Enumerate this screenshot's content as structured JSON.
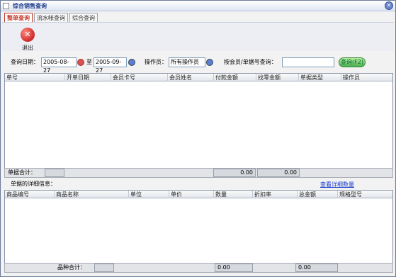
{
  "window": {
    "title": "综合销售查询",
    "close_symbol": "✕"
  },
  "tabs": [
    {
      "label": "整单查询",
      "active": true
    },
    {
      "label": "流水帐查询",
      "active": false
    },
    {
      "label": "综合查询",
      "active": false
    }
  ],
  "toolbar": {
    "exit_symbol": "✕",
    "exit_label": "退出"
  },
  "query": {
    "date_label": "查询日期：",
    "date_from": "2005-08-27",
    "to_label": "至",
    "date_to": "2005-09-27",
    "operator_label": "操作员：",
    "operator_value": "所有操作员",
    "member_label": "按会员/单据号查询：",
    "member_value": "",
    "query_button": "查询(F2)"
  },
  "orders_table": {
    "columns": [
      "单号",
      "开单日期",
      "会员卡号",
      "会员姓名",
      "付款金额",
      "找零金额",
      "单据类型",
      "操作员"
    ],
    "rows": []
  },
  "orders_summary": {
    "label": "单据合计：",
    "count": "",
    "amount": "0.00",
    "change": "0.00"
  },
  "detail": {
    "label": "单据的详细信息：",
    "link": "查看详细数量"
  },
  "detail_table": {
    "columns": [
      "商品编号",
      "商品名称",
      "单位",
      "单价",
      "数量",
      "折扣率",
      "总金额",
      "规格型号"
    ],
    "rows": []
  },
  "detail_summary": {
    "label": "品种合计：",
    "count": "",
    "quantity": "0.00",
    "total": "0.00"
  },
  "colors": {
    "accent": "#c0392b",
    "query_button": "#4caf50",
    "link": "#1a3fcc"
  }
}
